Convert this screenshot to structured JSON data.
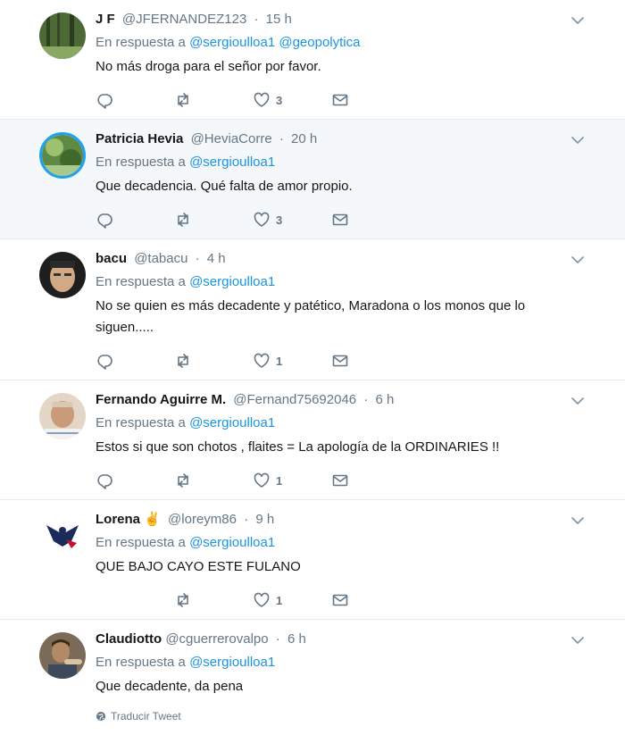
{
  "tweets": [
    {
      "name": "J F",
      "handle": "@JFERNANDEZ123",
      "time": "15 h",
      "reply_prefix": "En respuesta a",
      "mentions": "@sergioulloa1 @geopolytica",
      "text": "No más droga para el señor por favor.",
      "likes": "3",
      "avatar_colors": [
        "#3d5a2a",
        "#7c9a5a"
      ],
      "highlighted": false
    },
    {
      "name": "Patricia Hevia",
      "handle": "@HeviaCorre",
      "time": "20 h",
      "reply_prefix": "En respuesta a",
      "mentions": "@sergioulloa1",
      "text": "Que decadencia. Qué falta de amor propio.",
      "likes": "3",
      "avatar_colors": [
        "#4a7a3a",
        "#9bbf6a"
      ],
      "highlighted": true
    },
    {
      "name": "bacu",
      "handle": "@tabacu",
      "time": "4 h",
      "reply_prefix": "En respuesta a",
      "mentions": "@sergioulloa1",
      "text": "No se quien es más decadente y patético, Maradona o los monos que lo siguen.....",
      "likes": "1",
      "avatar_colors": [
        "#2a2a2a",
        "#c9a27e"
      ],
      "highlighted": false
    },
    {
      "name": "Fernando Aguirre M.",
      "handle": "@Fernand75692046",
      "time": "6 h",
      "reply_prefix": "En respuesta a",
      "mentions": "@sergioulloa1",
      "text": "Estos si que son chotos , flaites = La apología de la ORDINARIES !!",
      "likes": "1",
      "avatar_colors": [
        "#c8a890",
        "#e9d7c4"
      ],
      "highlighted": false
    },
    {
      "name": "Lorena",
      "emoji": "✌",
      "handle": "@loreym86",
      "time": "9 h",
      "reply_prefix": "En respuesta a",
      "mentions": "@sergioulloa1",
      "text": "QUE BAJO CAYO ESTE FULANO",
      "likes": "1",
      "avatar_colors": [
        "#ffffff",
        "#1a2a5a"
      ],
      "highlighted": false
    },
    {
      "name": "Claudiotto",
      "handle": "@cguerrerovalpo",
      "time": "6 h",
      "reply_prefix": "En respuesta a",
      "mentions": "@sergioulloa1",
      "text": "Que decadente, da pena",
      "translate": "Traducir Tweet",
      "likes": "",
      "avatar_colors": [
        "#6b5a48",
        "#b8a48a"
      ],
      "highlighted": false
    }
  ],
  "icons": {
    "reply": "reply-icon",
    "retweet": "retweet-icon",
    "like": "heart-icon",
    "dm": "envelope-icon",
    "more": "chevron-down-icon",
    "globe": "globe-icon"
  },
  "colors": {
    "link": "#1b95e0",
    "muted": "#657786",
    "highlight_bg": "#f5f8fa"
  }
}
